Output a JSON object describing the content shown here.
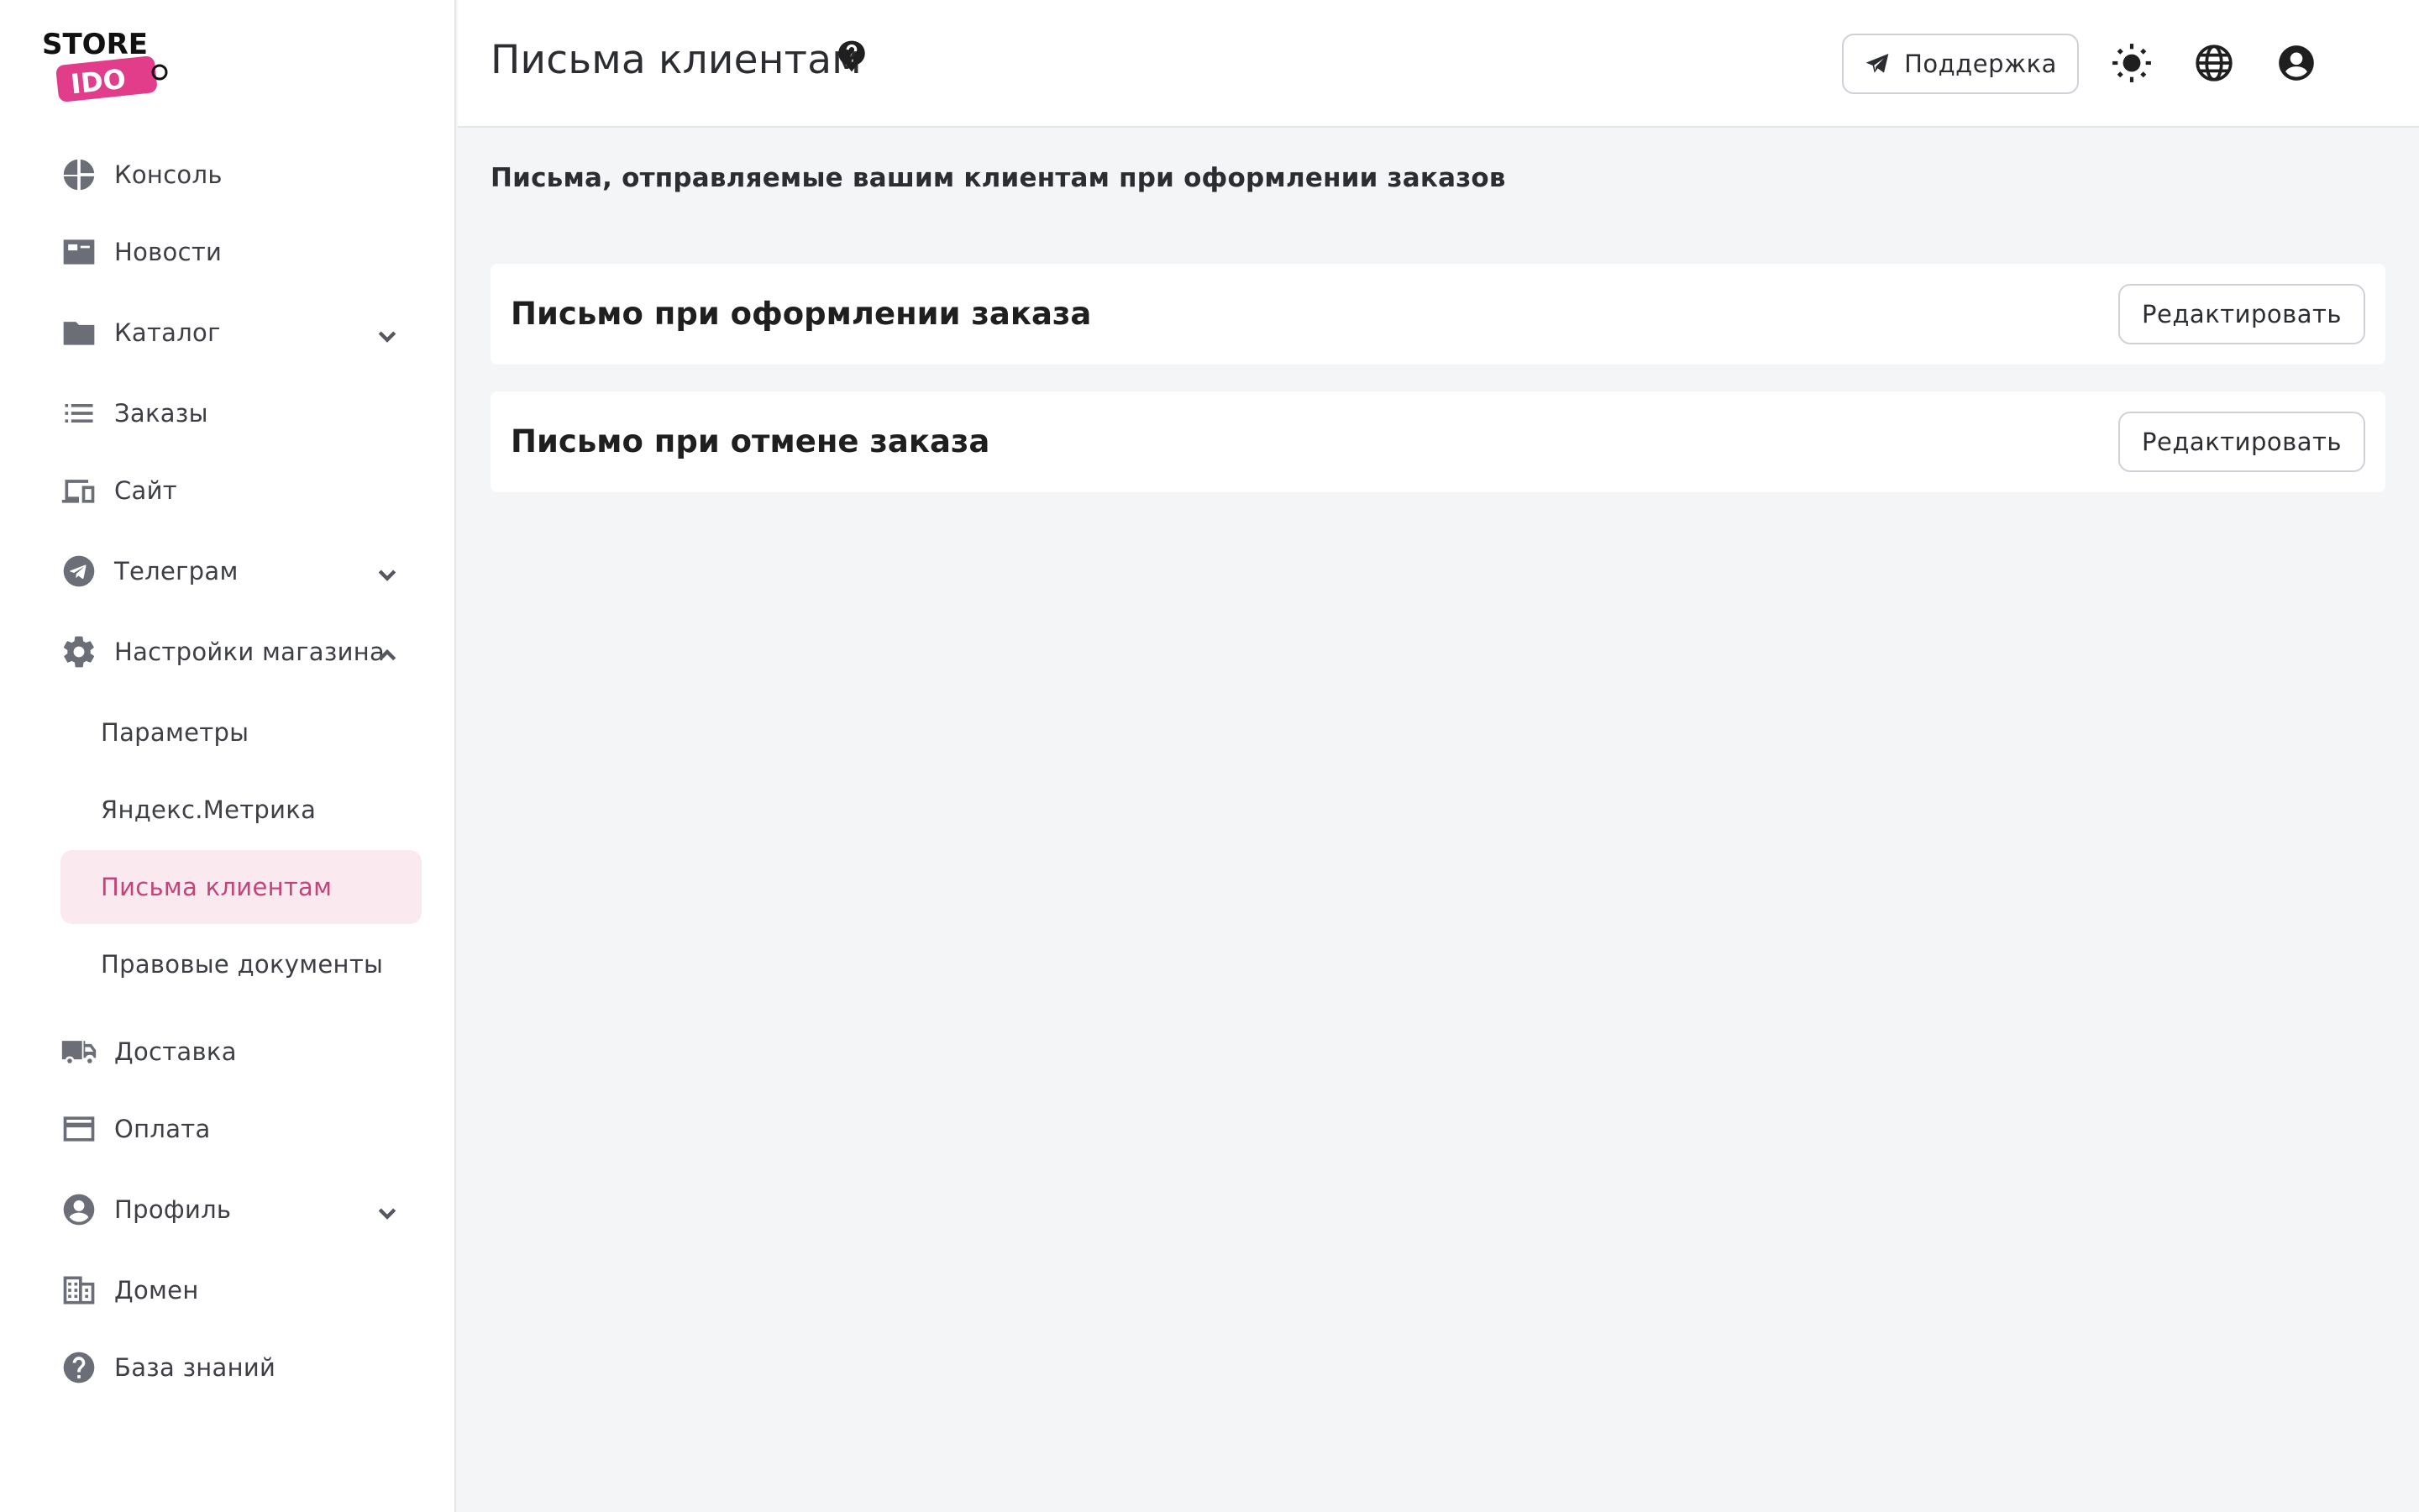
{
  "logo": {
    "text_top": "STORE",
    "text_bottom": "IDO"
  },
  "sidebar": {
    "items": [
      {
        "label": "Консоль",
        "icon": "console-icon"
      },
      {
        "label": "Новости",
        "icon": "news-icon"
      },
      {
        "label": "Каталог",
        "icon": "folder-icon",
        "chevron": "down"
      },
      {
        "label": "Заказы",
        "icon": "list-icon"
      },
      {
        "label": "Сайт",
        "icon": "devices-icon"
      },
      {
        "label": "Телеграм",
        "icon": "telegram-icon",
        "chevron": "down"
      },
      {
        "label": "Настройки магазина",
        "icon": "gear-icon",
        "chevron": "up"
      },
      {
        "label": "Доставка",
        "icon": "truck-icon"
      },
      {
        "label": "Оплата",
        "icon": "credit-card-icon"
      },
      {
        "label": "Профиль",
        "icon": "user-circle-icon",
        "chevron": "down"
      },
      {
        "label": "Домен",
        "icon": "building-icon"
      },
      {
        "label": "База знаний",
        "icon": "help-circle-icon"
      }
    ],
    "subitems": [
      {
        "label": "Параметры"
      },
      {
        "label": "Яндекс.Метрика"
      },
      {
        "label": "Письма клиентам",
        "active": true
      },
      {
        "label": "Правовые документы"
      }
    ]
  },
  "header": {
    "title": "Письма клиентам",
    "support_label": "Поддержка"
  },
  "main": {
    "description": "Письма, отправляемые вашим клиентам при оформлении заказов",
    "cards": [
      {
        "title": "Письмо при оформлении заказа",
        "button": "Редактировать"
      },
      {
        "title": "Письмо при отмене заказа",
        "button": "Редактировать"
      }
    ]
  },
  "colors": {
    "accent": "#c2447a",
    "accent_bg": "#fbe9f0",
    "logo_pink": "#e23d8a",
    "background": "#f4f5f7"
  }
}
